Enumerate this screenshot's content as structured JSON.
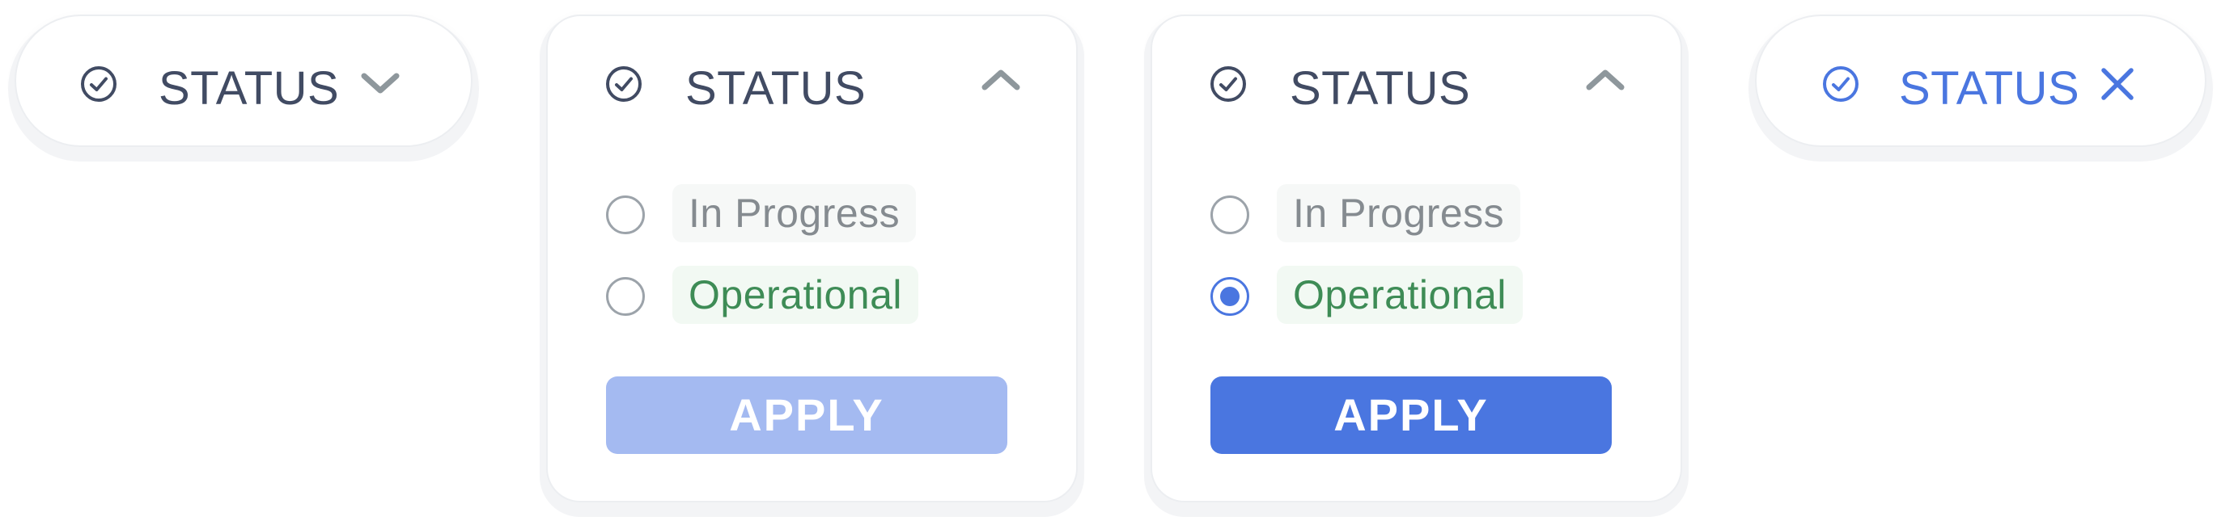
{
  "filters": [
    {
      "state": "collapsed",
      "title": "STATUS",
      "icon": "check-circle-icon",
      "toggle_icon": "chevron-down-icon"
    },
    {
      "state": "expanded-empty",
      "title": "STATUS",
      "icon": "check-circle-icon",
      "toggle_icon": "chevron-up-icon",
      "options": [
        {
          "label": "In Progress",
          "checked": false
        },
        {
          "label": "Operational",
          "checked": false
        }
      ],
      "apply_label": "APPLY",
      "apply_enabled": false
    },
    {
      "state": "expanded-selected",
      "title": "STATUS",
      "icon": "check-circle-icon",
      "toggle_icon": "chevron-up-icon",
      "options": [
        {
          "label": "In Progress",
          "checked": false
        },
        {
          "label": "Operational",
          "checked": true
        }
      ],
      "apply_label": "APPLY",
      "apply_enabled": true
    },
    {
      "state": "active",
      "title": "STATUS",
      "icon": "check-circle-icon",
      "toggle_icon": "close-icon"
    }
  ],
  "colors": {
    "text": "#414b63",
    "accent": "#4a76e0",
    "accent_disabled": "#a4baf1",
    "chevron": "#8e979c",
    "in_progress_text": "#858b90",
    "operational_text": "#3e8c56"
  }
}
